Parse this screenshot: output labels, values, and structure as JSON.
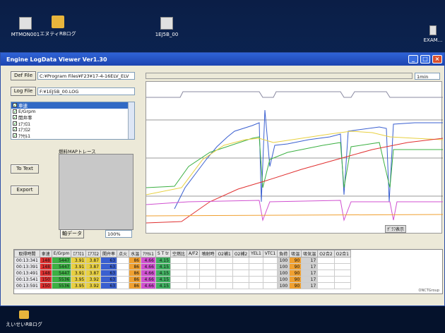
{
  "desktop": {
    "icons": [
      {
        "label": "MTMON001"
      },
      {
        "label": "エヌティRBログ"
      },
      {
        "label": "1EJ5B_00"
      },
      {
        "label": "EXAM..."
      },
      {
        "label": "えいせいRBログ"
      }
    ]
  },
  "window": {
    "title": "Engine LogData Viewer Ver1.30",
    "buttons": {
      "minimize": "_",
      "maximize": "□",
      "close": "×"
    }
  },
  "controls": {
    "def_file_label": "Def File",
    "def_file_value": "C:¥Program Files¥F23¥17-4-16ELV_ELV",
    "log_file_label": "Log File",
    "log_file_value": "F:¥1EJ5B_00.LOG",
    "to_text_label": "To Text",
    "export_label": "Export",
    "map_trace_label": "燃料MAPトレース",
    "axis_data_label": "軸データ",
    "zoom_value": "100%",
    "time_unit": "1min"
  },
  "channels": [
    {
      "label": "車速",
      "selected": true
    },
    {
      "label": "E/Grpm",
      "selected": false
    },
    {
      "label": "開弁率",
      "selected": false
    },
    {
      "label": "ｴｱﾌﾛ1",
      "selected": false
    },
    {
      "label": "ｴｱﾌﾛ2",
      "selected": false
    },
    {
      "label": "ｱｸｾﾙ1",
      "selected": false
    }
  ],
  "chart": {
    "overlay_label": "ｸﾞﾗﾌ表示"
  },
  "table": {
    "headers": [
      "取得時間",
      "車速",
      "E/Grpm",
      "ｴｱﾌﾛ1",
      "ｴｱﾌﾛ2",
      "開弁率",
      "点火",
      "水温",
      "ｱｸｾﾙ1",
      "S T tr",
      "空燃比",
      "A/F2",
      "噴射時",
      "O2補1",
      "O2補2",
      "YEL1",
      "VTC1",
      "負荷",
      "吸温",
      "吸気温",
      "O2合2",
      "O2合1"
    ],
    "rows": [
      [
        "00:13:341",
        "148",
        "5447",
        "3.91",
        "3.87",
        "63",
        "",
        "86",
        "4.66",
        "4.15",
        "",
        "",
        "",
        "",
        "",
        "",
        "",
        "100",
        "90",
        "17",
        "",
        ""
      ],
      [
        "00:13:391",
        "148",
        "5447",
        "3.91",
        "3.87",
        "63",
        "",
        "86",
        "4.66",
        "4.15",
        "",
        "",
        "",
        "",
        "",
        "",
        "",
        "100",
        "90",
        "17",
        "",
        ""
      ],
      [
        "00:13:491",
        "148",
        "5447",
        "3.91",
        "3.87",
        "63",
        "",
        "86",
        "4.66",
        "4.15",
        "",
        "",
        "",
        "",
        "",
        "",
        "",
        "100",
        "90",
        "17",
        "",
        ""
      ],
      [
        "00:13:541",
        "150",
        "5536",
        "3.95",
        "3.92",
        "63",
        "",
        "86",
        "4.66",
        "4.15",
        "",
        "",
        "",
        "",
        "",
        "",
        "",
        "100",
        "90",
        "17",
        "",
        ""
      ],
      [
        "00:13:591",
        "150",
        "5536",
        "3.95",
        "3.92",
        "63",
        "",
        "86",
        "4.66",
        "4.15",
        "",
        "",
        "",
        "",
        "",
        "",
        "",
        "100",
        "90",
        "17",
        "",
        ""
      ]
    ],
    "status_text": "ONCTGroup"
  },
  "colors": {
    "speed": "#e03030",
    "rpm": "#3cb043",
    "afr": "#e8d040",
    "throttle": "#3a5fd0",
    "water": "#f0a030",
    "accel": "#d050d0",
    "st": "#40b060",
    "load": "#d0d0d0"
  }
}
